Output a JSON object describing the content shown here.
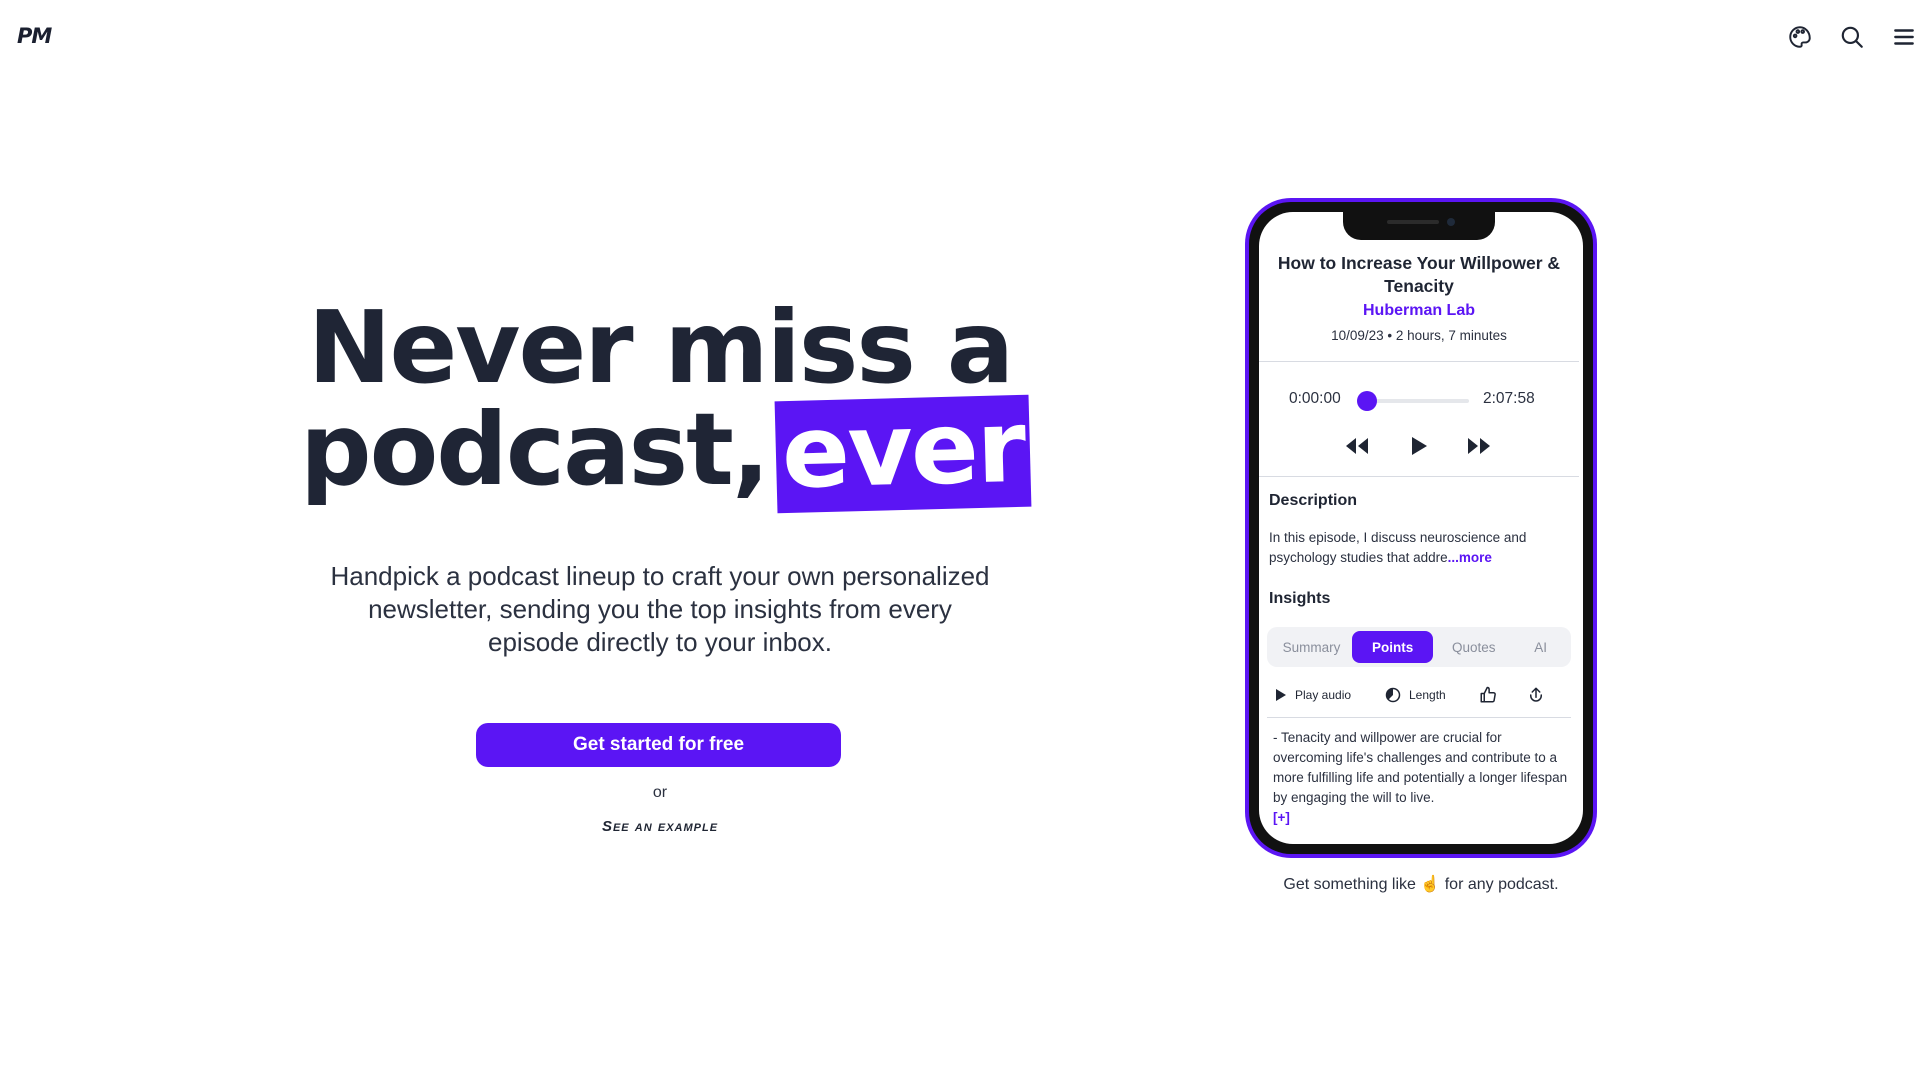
{
  "header": {
    "logo": "PM",
    "icons": [
      "palette-icon",
      "search-icon",
      "menu-icon"
    ]
  },
  "hero": {
    "headline_line1": "Never miss a",
    "headline_line2": "podcast,",
    "headline_highlight": "ever",
    "subtitle": "Handpick a podcast lineup to craft your own personalized newsletter, sending you the top insights from every episode directly to your inbox.",
    "cta_label": "Get started for free",
    "or_text": "or",
    "example_link": "See an example"
  },
  "phone": {
    "episode_title": "How to Increase Your Willpower & Tenacity",
    "show_name": "Huberman Lab",
    "meta": "10/09/23 • 2 hours, 7 minutes",
    "player": {
      "current_time": "0:00:00",
      "total_time": "2:07:58",
      "progress": 0
    },
    "description": {
      "heading": "Description",
      "text": "In this episode, I discuss neuroscience and psychology studies that addre",
      "more_label": "...more"
    },
    "insights": {
      "heading": "Insights",
      "tabs": [
        "Summary",
        "Points",
        "Quotes",
        "AI"
      ],
      "active_tab": "Points",
      "actions": {
        "play_audio": "Play audio",
        "length": "Length"
      },
      "point_text": "- Tenacity and willpower are crucial for overcoming life's challenges and contribute to a more fulfilling life and potentially a longer lifespan by engaging the will to live.",
      "expand_label": "[+]"
    }
  },
  "caption": "Get something like ☝️ for any podcast.",
  "colors": {
    "accent": "#5b15f4",
    "text": "#1f2533"
  }
}
